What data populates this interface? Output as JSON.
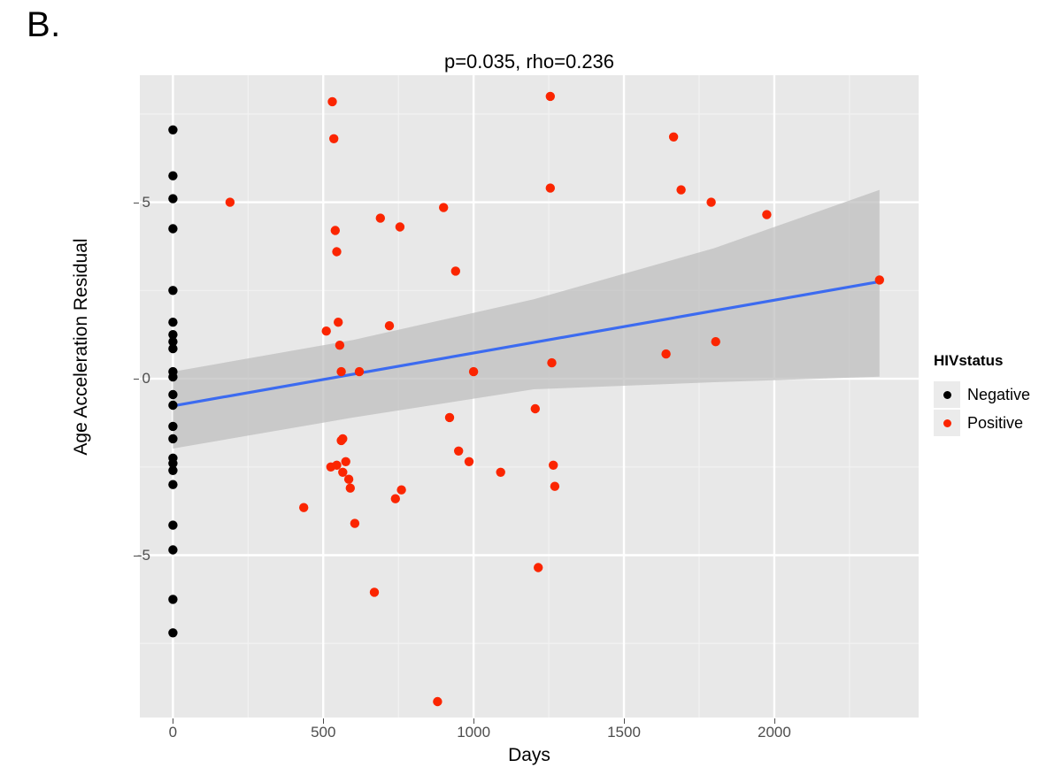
{
  "panel_letter": "B.",
  "legend": {
    "title": "HIVstatus",
    "entries": [
      {
        "label": "Negative",
        "color": "#000000"
      },
      {
        "label": "Positive",
        "color": "#fb2500"
      }
    ]
  },
  "chart_data": {
    "type": "scatter",
    "title": "p=0.035, rho=0.236",
    "xlabel": "Days",
    "ylabel": "Age Acceleration Residual",
    "xlim": [
      -110,
      2480
    ],
    "ylim": [
      -9.6,
      8.6
    ],
    "xticks": [
      0,
      500,
      1000,
      1500,
      2000
    ],
    "yticks": [
      5,
      0,
      -5
    ],
    "xtick_labels": [
      "0",
      "500",
      "1000",
      "1500",
      "2000"
    ],
    "ytick_labels": [
      "5",
      "0",
      "-5"
    ],
    "grid": true,
    "panel_background": "#e8e8e8",
    "grid_major_color": "#ffffff",
    "grid_minor_color": "#f2f2f2",
    "legend_position": "right",
    "annotations": [
      "p=0.035",
      "rho=0.236"
    ],
    "series": [
      {
        "name": "Negative",
        "color": "#000000",
        "points": [
          [
            0,
            7.05
          ],
          [
            0,
            5.75
          ],
          [
            0,
            5.1
          ],
          [
            0,
            4.25
          ],
          [
            0,
            2.5
          ],
          [
            0,
            1.6
          ],
          [
            0,
            1.25
          ],
          [
            0,
            1.05
          ],
          [
            0,
            0.85
          ],
          [
            0,
            0.2
          ],
          [
            0,
            0.05
          ],
          [
            0,
            -0.45
          ],
          [
            0,
            -0.75
          ],
          [
            0,
            -1.35
          ],
          [
            0,
            -1.7
          ],
          [
            0,
            -2.25
          ],
          [
            0,
            -2.4
          ],
          [
            0,
            -2.6
          ],
          [
            0,
            -3.0
          ],
          [
            0,
            -4.15
          ],
          [
            0,
            -4.85
          ],
          [
            0,
            -6.25
          ],
          [
            0,
            -7.2
          ]
        ]
      },
      {
        "name": "Positive",
        "color": "#fb2500",
        "points": [
          [
            190,
            5.0
          ],
          [
            435,
            -3.65
          ],
          [
            510,
            1.35
          ],
          [
            530,
            7.85
          ],
          [
            535,
            6.8
          ],
          [
            540,
            4.2
          ],
          [
            545,
            3.6
          ],
          [
            550,
            1.6
          ],
          [
            555,
            0.95
          ],
          [
            560,
            0.2
          ],
          [
            560,
            -1.75
          ],
          [
            565,
            -1.7
          ],
          [
            525,
            -2.5
          ],
          [
            545,
            -2.45
          ],
          [
            565,
            -2.65
          ],
          [
            575,
            -2.35
          ],
          [
            585,
            -2.85
          ],
          [
            590,
            -3.1
          ],
          [
            605,
            -4.1
          ],
          [
            620,
            0.2
          ],
          [
            670,
            -6.05
          ],
          [
            690,
            4.55
          ],
          [
            720,
            1.5
          ],
          [
            740,
            -3.4
          ],
          [
            755,
            4.3
          ],
          [
            760,
            -3.15
          ],
          [
            880,
            -9.15
          ],
          [
            900,
            4.85
          ],
          [
            920,
            -1.1
          ],
          [
            940,
            3.05
          ],
          [
            950,
            -2.05
          ],
          [
            985,
            -2.35
          ],
          [
            1000,
            0.2
          ],
          [
            1090,
            -2.65
          ],
          [
            1205,
            -0.85
          ],
          [
            1255,
            8.0
          ],
          [
            1255,
            5.4
          ],
          [
            1260,
            0.45
          ],
          [
            1265,
            -2.45
          ],
          [
            1270,
            -3.05
          ],
          [
            1215,
            -5.35
          ],
          [
            1640,
            0.7
          ],
          [
            1665,
            6.85
          ],
          [
            1690,
            5.35
          ],
          [
            1790,
            5.0
          ],
          [
            1805,
            1.05
          ],
          [
            1975,
            4.65
          ],
          [
            2350,
            2.8
          ]
        ]
      }
    ],
    "fit_line": {
      "color": "#3c6bf0",
      "x_start": 0,
      "y_start": -0.77,
      "x_end": 2350,
      "y_end": 2.75
    },
    "confidence_band": {
      "color": "#bfbfbf",
      "opacity": 0.75,
      "upper": [
        [
          0,
          0.2
        ],
        [
          600,
          1.1
        ],
        [
          1200,
          2.25
        ],
        [
          1800,
          3.7
        ],
        [
          2350,
          5.35
        ]
      ],
      "lower": [
        [
          0,
          -1.98
        ],
        [
          600,
          -1.1
        ],
        [
          1200,
          -0.3
        ],
        [
          1800,
          -0.1
        ],
        [
          2350,
          0.06
        ]
      ]
    }
  }
}
